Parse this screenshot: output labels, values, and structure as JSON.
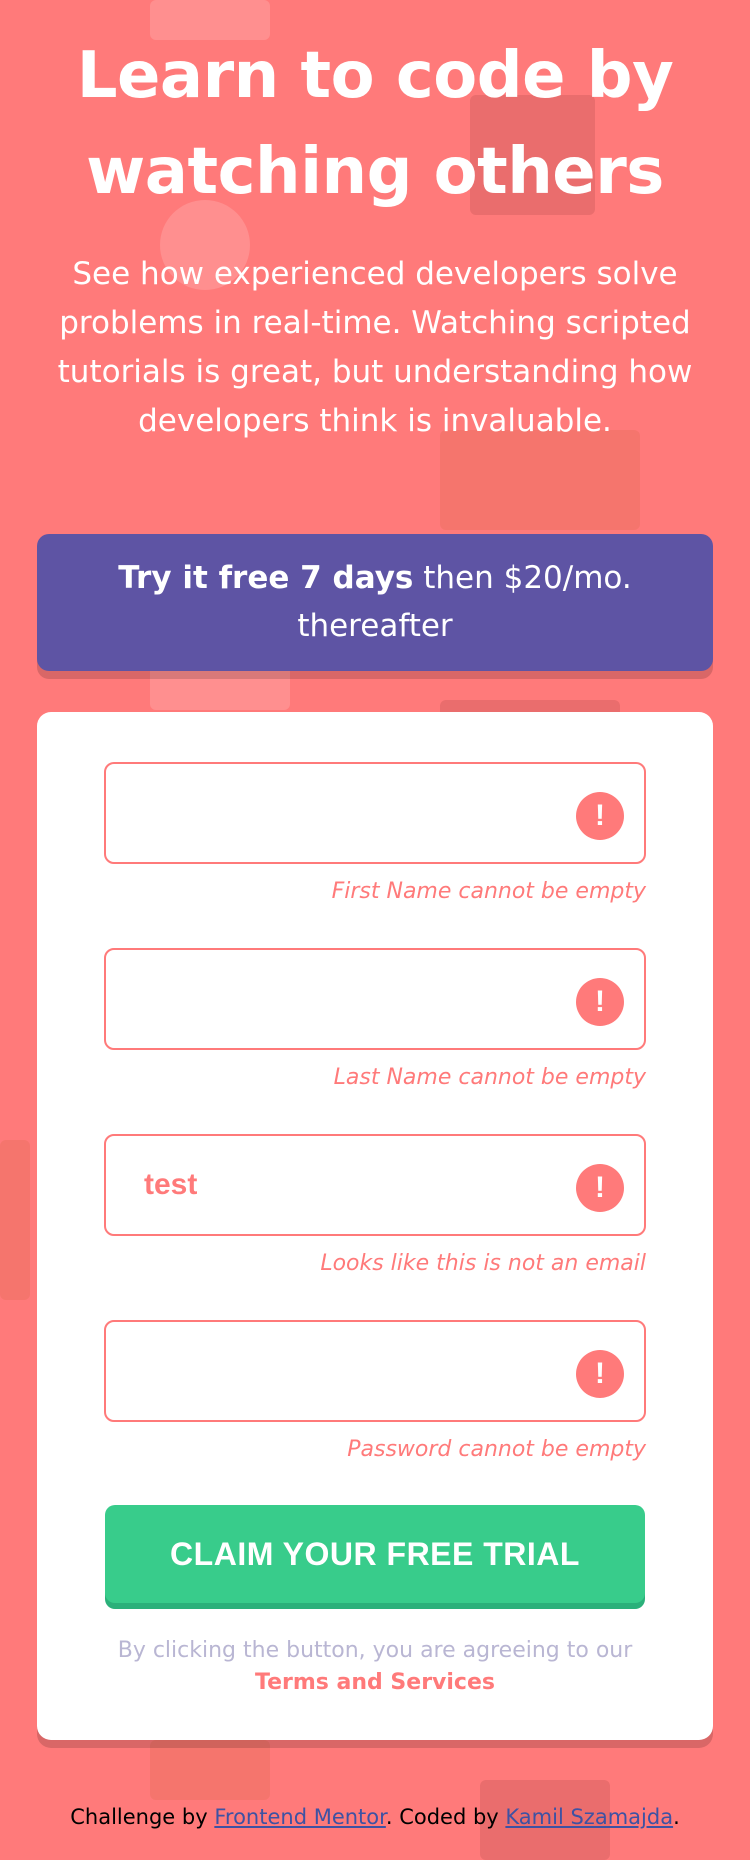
{
  "hero": {
    "title_line1": "Learn to code by",
    "title_line2": "watching others",
    "text": "See how experienced developers solve problems in real-time. Watching scripted tutorials is great, but understanding how developers think is invaluable."
  },
  "promo": {
    "bold": "Try it free 7 days",
    "rest": " then $20/mo. thereafter"
  },
  "form": {
    "fields": [
      {
        "value": "",
        "error": "First Name cannot be empty",
        "icon": "error-icon"
      },
      {
        "value": "",
        "error": "Last Name cannot be empty",
        "icon": "error-icon"
      },
      {
        "value": "test",
        "error": "Looks like this is not an email",
        "icon": "error-icon"
      },
      {
        "value": "",
        "error": "Password cannot be empty",
        "icon": "error-icon"
      }
    ],
    "error_glyph": "!",
    "submit_label": "CLAIM YOUR FREE TRIAL",
    "terms_prefix": "By clicking the button, you are agreeing to our",
    "terms_link": "Terms and Services"
  },
  "footer": {
    "prefix": "Challenge by ",
    "link1": "Frontend Mentor",
    "middle": ". Coded by ",
    "link2": "Kamil Szamajda",
    "suffix": "."
  },
  "colors": {
    "background": "#ff7a7a",
    "promo": "#5e54a4",
    "cta": "#38cc8b",
    "error": "#ff7a7a",
    "link": "#3e52a3"
  }
}
